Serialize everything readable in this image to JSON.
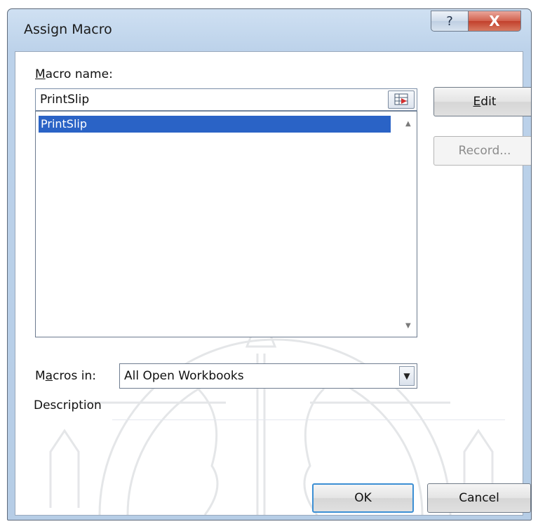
{
  "dialog": {
    "title": "Assign Macro",
    "help_glyph": "?",
    "close_glyph": "X"
  },
  "macro_name": {
    "label_first": "M",
    "label_rest": "acro name:",
    "value": "PrintSlip"
  },
  "macro_list": {
    "items": [
      {
        "label": "PrintSlip",
        "selected": true
      }
    ]
  },
  "buttons": {
    "edit_first": "E",
    "edit_rest": "dit",
    "record": "Record...",
    "ok": "OK",
    "cancel": "Cancel"
  },
  "macros_in": {
    "label_first": "M",
    "label_accel": "a",
    "label_rest": "cros in:",
    "value": "All Open Workbooks"
  },
  "description": {
    "label": "Description"
  },
  "colors": {
    "selection": "#2a63c6",
    "default_button_border": "#3c8fd4"
  }
}
